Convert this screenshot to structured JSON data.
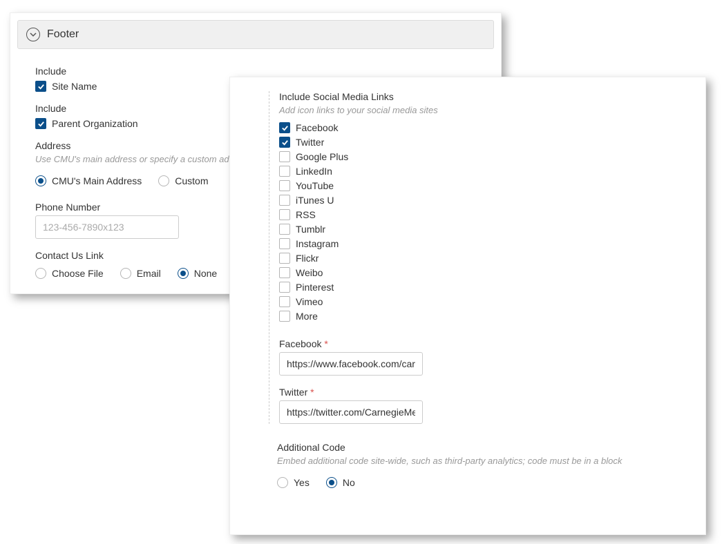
{
  "header": {
    "title": "Footer"
  },
  "include1": {
    "label": "Include",
    "options": [
      {
        "label": "Site Name",
        "checked": true
      }
    ]
  },
  "include2": {
    "label": "Include",
    "options": [
      {
        "label": "Parent Organization",
        "checked": true
      }
    ]
  },
  "address": {
    "label": "Address",
    "desc": "Use CMU's main address or specify a custom address",
    "options": [
      {
        "label": "CMU's Main Address",
        "selected": true
      },
      {
        "label": "Custom",
        "selected": false
      }
    ]
  },
  "phone": {
    "label": "Phone Number",
    "placeholder": "123-456-7890x123",
    "value": ""
  },
  "contact": {
    "label": "Contact Us Link",
    "options": [
      {
        "label": "Choose File",
        "selected": false
      },
      {
        "label": "Email",
        "selected": false
      },
      {
        "label": "None",
        "selected": true
      }
    ]
  },
  "social": {
    "label": "Include Social Media Links",
    "desc": "Add icon links to your social media sites",
    "items": [
      {
        "label": "Facebook",
        "checked": true
      },
      {
        "label": "Twitter",
        "checked": true
      },
      {
        "label": "Google Plus",
        "checked": false
      },
      {
        "label": "LinkedIn",
        "checked": false
      },
      {
        "label": "YouTube",
        "checked": false
      },
      {
        "label": "iTunes U",
        "checked": false
      },
      {
        "label": "RSS",
        "checked": false
      },
      {
        "label": "Tumblr",
        "checked": false
      },
      {
        "label": "Instagram",
        "checked": false
      },
      {
        "label": "Flickr",
        "checked": false
      },
      {
        "label": "Weibo",
        "checked": false
      },
      {
        "label": "Pinterest",
        "checked": false
      },
      {
        "label": "Vimeo",
        "checked": false
      },
      {
        "label": "More",
        "checked": false
      }
    ],
    "facebook": {
      "label": "Facebook",
      "req": "*",
      "value": "https://www.facebook.com/carnegiemellonu/"
    },
    "twitter": {
      "label": "Twitter",
      "req": "*",
      "value": "https://twitter.com/CarnegieMellon"
    }
  },
  "additional": {
    "label": "Additional Code",
    "desc": "Embed additional code site-wide, such as third-party analytics; code must be in a block",
    "options": [
      {
        "label": "Yes",
        "selected": false
      },
      {
        "label": "No",
        "selected": true
      }
    ]
  }
}
